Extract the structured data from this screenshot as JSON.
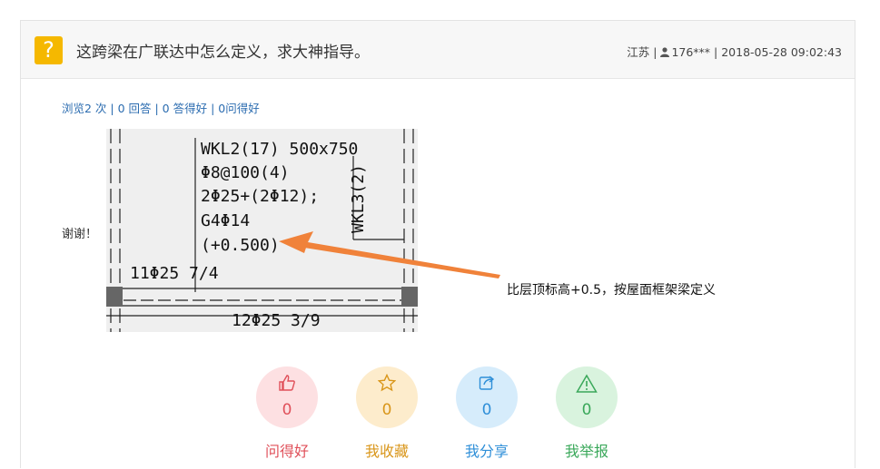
{
  "question": {
    "title": "这跨梁在广联达中怎么定义，求大神指导。",
    "location": "江苏",
    "user": "176***",
    "datetime": "2018-05-28 09:02:43",
    "icon": "question-icon"
  },
  "stats": "浏览2 次 | 0 回答 | 0 答得好 | 0问得好",
  "body_text": "谢谢！",
  "drawing": {
    "beam_line1": "WKL2(17) 500x750",
    "beam_line2": "Φ8@100(4)",
    "beam_line3": "2Φ25+(2Φ12);",
    "beam_line4": "G4Φ14",
    "beam_line5": "(+0.500)",
    "side_label": "WKL3(2)",
    "top_rebar": "11Φ25 7/4",
    "bottom_rebar": "12Φ25 3/9",
    "annotation": "比层顶标高+0.5，按屋面框架梁定义",
    "arrow_color": "#f0823a"
  },
  "actions": [
    {
      "name": "问得好",
      "count": "0",
      "icon": "thumbs-up-icon",
      "color": "#e0505a",
      "bg": "#fde0e2"
    },
    {
      "name": "我收藏",
      "count": "0",
      "icon": "star-icon",
      "color": "#d9961a",
      "bg": "#fdeccc"
    },
    {
      "name": "我分享",
      "count": "0",
      "icon": "share-icon",
      "color": "#2f8fd8",
      "bg": "#d6ecfb"
    },
    {
      "name": "我举报",
      "count": "0",
      "icon": "warning-icon",
      "color": "#3aa85a",
      "bg": "#d9f3de"
    }
  ]
}
